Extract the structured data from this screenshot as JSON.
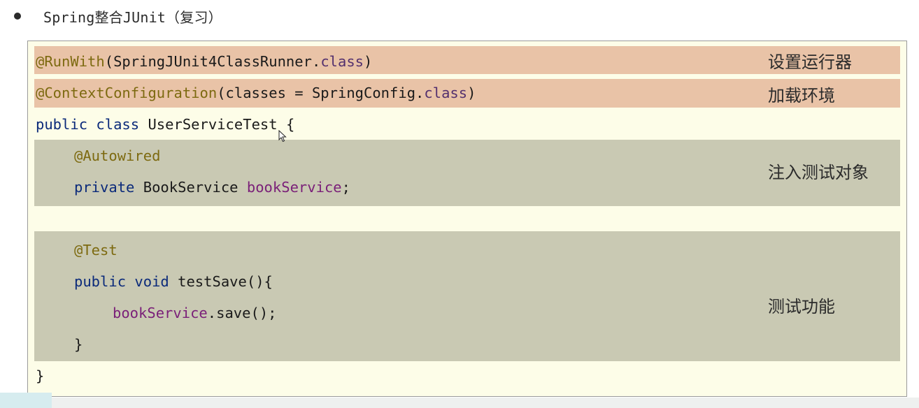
{
  "heading": {
    "text": "Spring整合JUnit（复习）"
  },
  "code": {
    "run_with": {
      "annotation": "@RunWith",
      "open": "(SpringJUnit4ClassRunner.",
      "class_kw": "class",
      "close": ")"
    },
    "context_config": {
      "annotation": "@ContextConfiguration",
      "open": "(classes = SpringConfig.",
      "class_kw": "class",
      "close": ")"
    },
    "class_decl": {
      "kw_public": "public",
      "kw_class": "class",
      "name": "UserServiceTest {"
    },
    "autowired": "@Autowired",
    "field_decl": {
      "kw_private": "private",
      "type": "BookService",
      "field": "bookService",
      "end": ";"
    },
    "test_annotation": "@Test",
    "method_decl": {
      "kw_public": "public",
      "kw_void": "void",
      "name": "testSave(){"
    },
    "call": {
      "field": "bookService",
      "rest": ".save();"
    },
    "method_close": "}",
    "class_close": "}"
  },
  "notes": {
    "runner": "设置运行器",
    "env": "加载环境",
    "inject": "注入测试对象",
    "test": "测试功能"
  },
  "colors": {
    "panel_bg": "#fdfde8",
    "highlight_red": "#e9c3a7",
    "highlight_gray": "#c9c9b3",
    "keyword": "#0b2a7a",
    "annotation": "#7d6a10",
    "field": "#7a1f78"
  },
  "icons": [
    "bullet-icon",
    "mouse-cursor-icon"
  ]
}
